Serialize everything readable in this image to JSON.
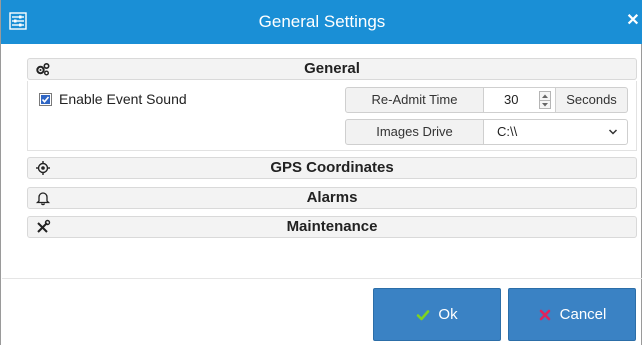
{
  "dialog": {
    "title": "General Settings",
    "close_symbol": "✕"
  },
  "sections": {
    "general": {
      "title": "General",
      "icon": "gears-icon"
    },
    "gps": {
      "title": "GPS Coordinates",
      "icon": "location-target-icon"
    },
    "alarms": {
      "title": "Alarms",
      "icon": "bell-icon"
    },
    "maintenance": {
      "title": "Maintenance",
      "icon": "tools-icon"
    }
  },
  "general": {
    "enable_event_sound": {
      "label": "Enable Event Sound",
      "checked": true
    },
    "readmit": {
      "label": "Re-Admit Time",
      "value": "30",
      "unit": "Seconds"
    },
    "images_drive": {
      "label": "Images Drive",
      "value": "C:\\\\"
    }
  },
  "buttons": {
    "ok": "Ok",
    "cancel": "Cancel"
  },
  "colors": {
    "titlebar": "#1a8fd6",
    "button": "#3a82c4",
    "ok_check": "#7ed321",
    "cancel_x": "#e0245e"
  }
}
